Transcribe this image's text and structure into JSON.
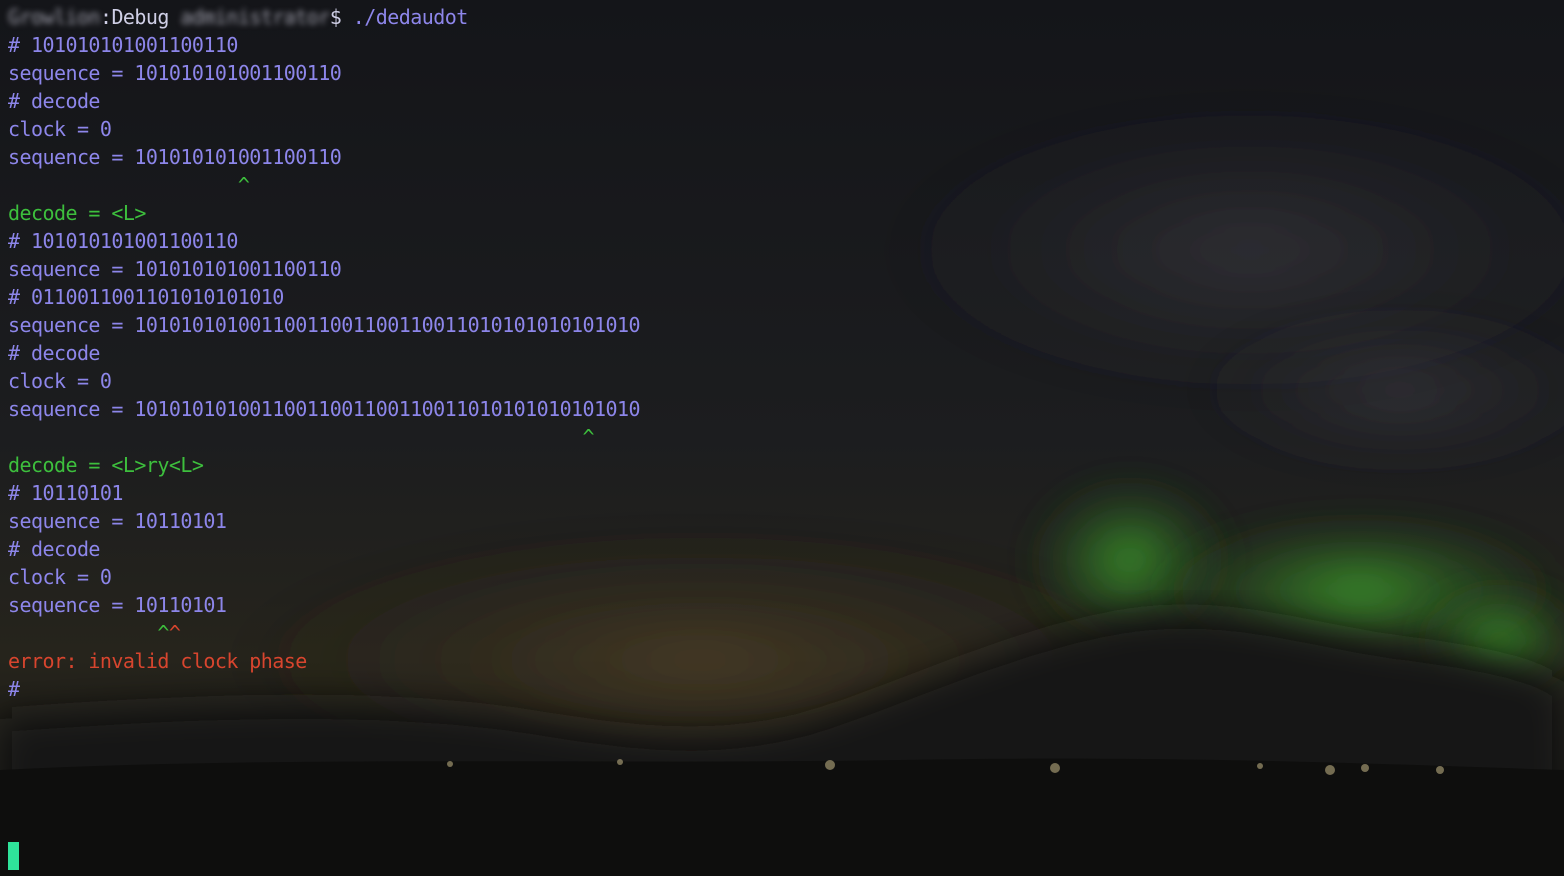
{
  "prompt": {
    "host": "Growlion",
    "cwd": "Debug",
    "user": "administrator",
    "symbol": "$",
    "command": " ./dedaudot"
  },
  "lines": [
    {
      "text": "# 101010101001100110",
      "color": "purple"
    },
    {
      "text": "sequence = 101010101001100110",
      "color": "purple"
    },
    {
      "text": "# decode",
      "color": "purple"
    },
    {
      "text": "clock = 0",
      "color": "purple"
    },
    {
      "text": "sequence = 101010101001100110",
      "color": "purple"
    },
    {
      "text": "                    ^",
      "color": "green"
    },
    {
      "text": "decode = <L>",
      "color": "green"
    },
    {
      "text": "# 101010101001100110",
      "color": "purple"
    },
    {
      "text": "sequence = 101010101001100110",
      "color": "purple"
    },
    {
      "text": "# 0110011001101010101010",
      "color": "purple"
    },
    {
      "text": "sequence = 10101010100110011001100110011010101010101010",
      "color": "purple"
    },
    {
      "text": "# decode",
      "color": "purple"
    },
    {
      "text": "clock = 0",
      "color": "purple"
    },
    {
      "text": "sequence = 10101010100110011001100110011010101010101010",
      "color": "purple"
    },
    {
      "text": "                                                  ^",
      "color": "green"
    },
    {
      "text": "decode = <L>ry<L>",
      "color": "green"
    },
    {
      "text": "# 10110101",
      "color": "purple"
    },
    {
      "text": "sequence = 10110101",
      "color": "purple"
    },
    {
      "text": "# decode",
      "color": "purple"
    },
    {
      "text": "clock = 0",
      "color": "purple"
    },
    {
      "text": "sequence = 10110101",
      "color": "purple"
    },
    {
      "text": "             ^^",
      "color": "caret-mix"
    },
    {
      "text": "error: invalid clock phase",
      "color": "red"
    },
    {
      "text": "#",
      "color": "purple"
    }
  ],
  "colors": {
    "purple": "#8d86ea",
    "green": "#3dbf3d",
    "red": "#d8452e",
    "cursor": "#2fe39a"
  }
}
